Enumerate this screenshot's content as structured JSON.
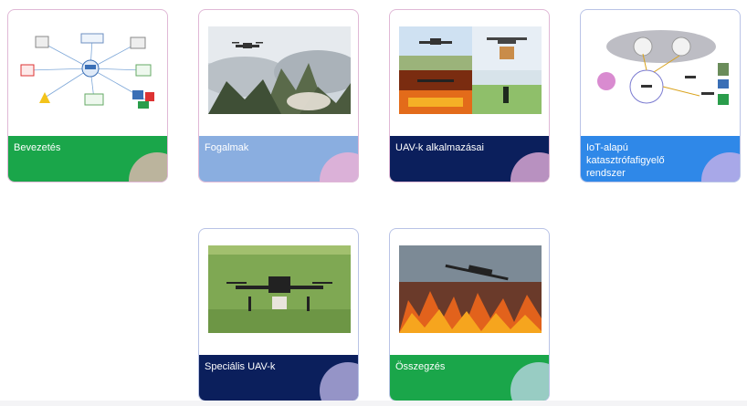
{
  "cards": [
    {
      "id": "bevezetes",
      "label": "Bevezetés",
      "band_color": "#1aa64a",
      "circle_color": "#e9b8b5",
      "thumb": "network-diagram"
    },
    {
      "id": "fogalmak",
      "label": "Fogalmak",
      "band_color": "#8aaee0",
      "circle_color": "#f2b2d6",
      "thumb": "drone-over-wildfire-smoke"
    },
    {
      "id": "uav-k-alkalmazasai",
      "label": "UAV-k alkalmazásai",
      "band_color": "#0b1f5c",
      "circle_color": "#e9b2dc",
      "thumb": "uav-applications-collage"
    },
    {
      "id": "iot-alapu",
      "label": "IoT-alapú katasztrófafigyelő rendszer",
      "band_color": "#2f88e8",
      "circle_color": "#cbb1e8",
      "thumb": "iot-disaster-diagram"
    },
    {
      "id": "specialis-uav-k",
      "label": "Speciális UAV-k",
      "band_color": "#0b1f5c",
      "circle_color": "#bcb6e6",
      "thumb": "drone-on-grass"
    },
    {
      "id": "osszegzes",
      "label": "Összegzés",
      "band_color": "#1aa64a",
      "circle_color": "#bcd7e6",
      "thumb": "fixed-wing-over-fire"
    }
  ]
}
